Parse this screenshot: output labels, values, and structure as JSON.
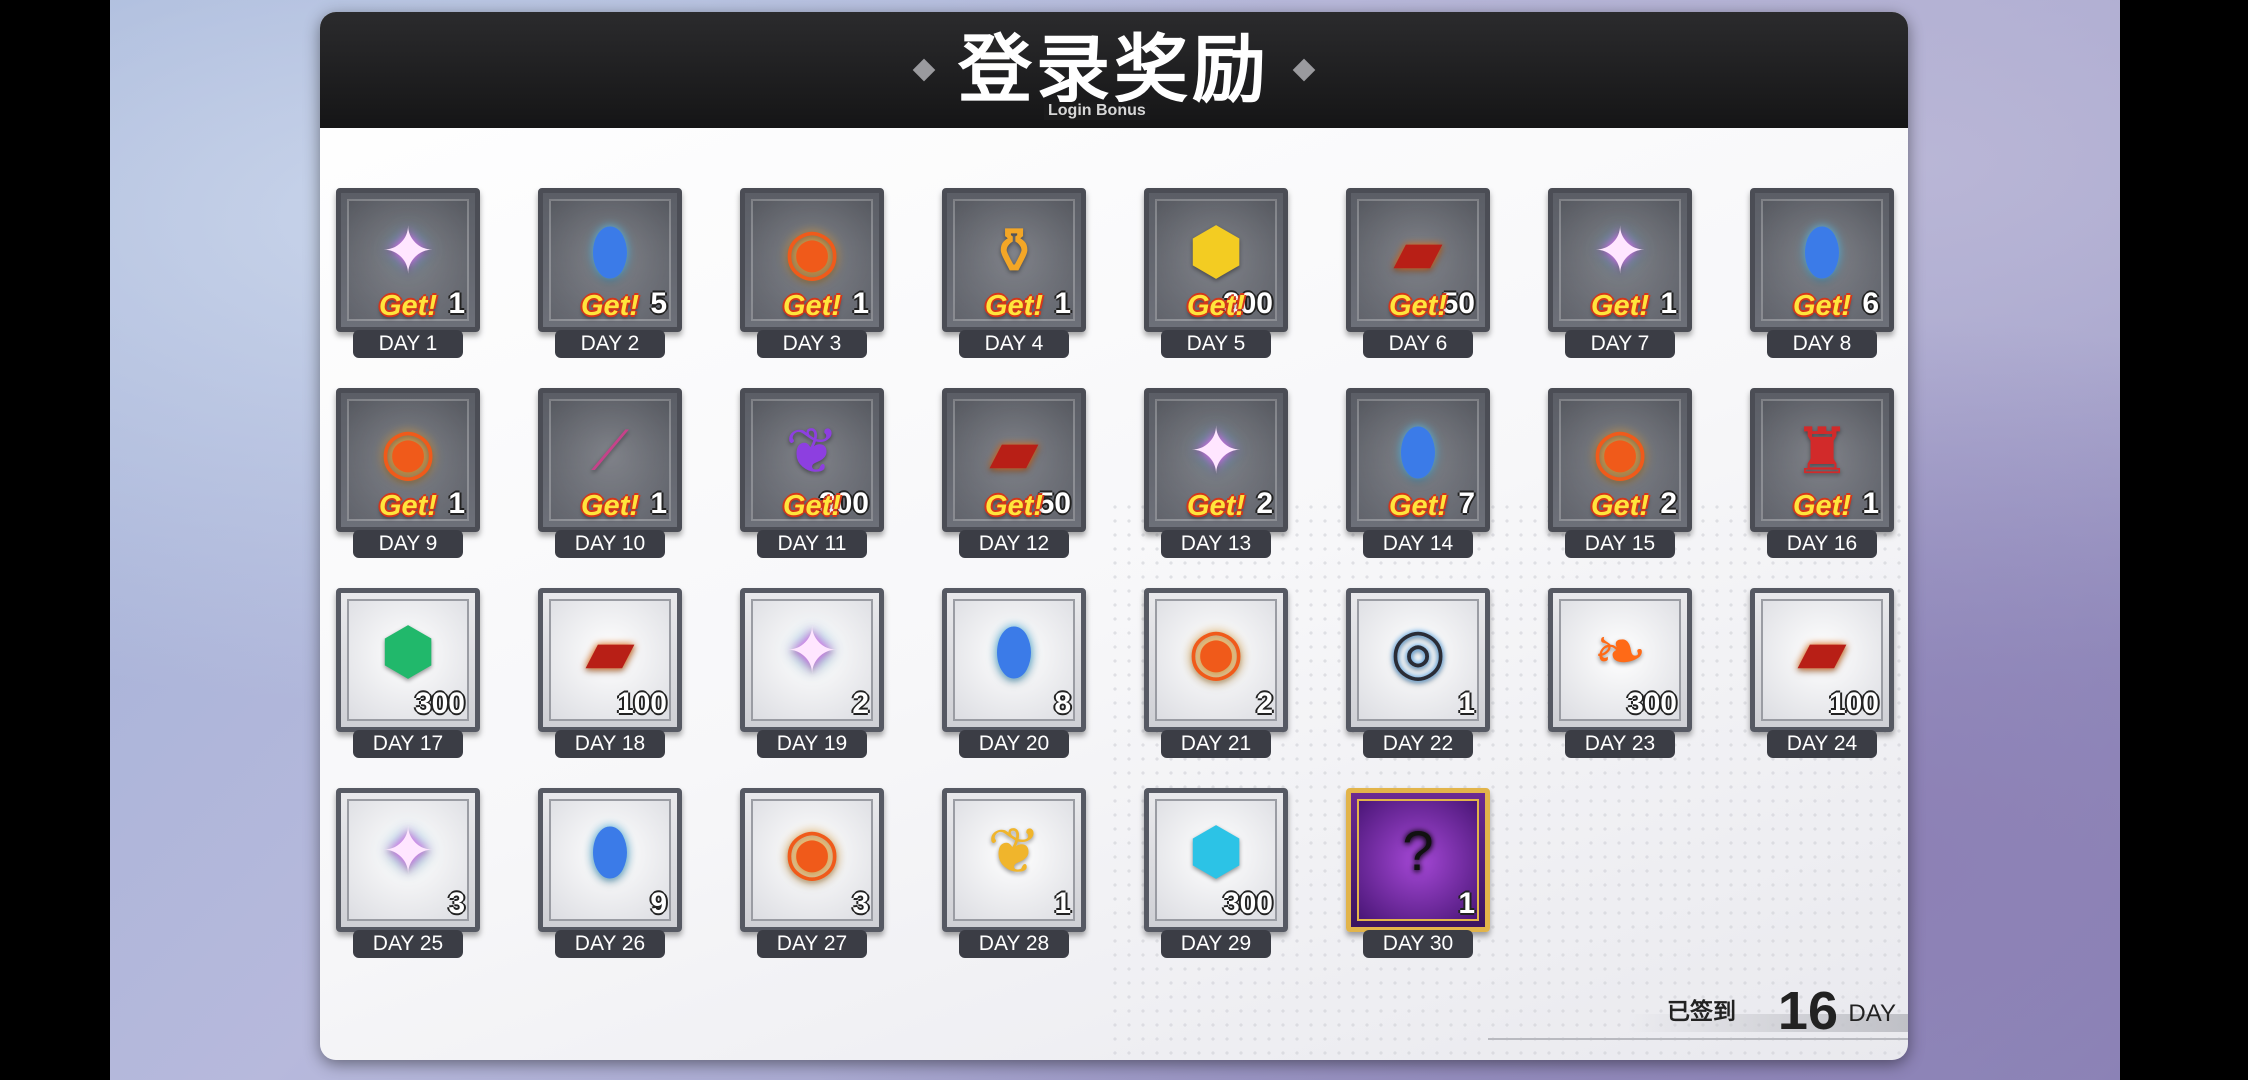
{
  "header": {
    "title": "登录奖励",
    "subtitle": "Login Bonus"
  },
  "days": [
    {
      "label": "DAY 1",
      "qty": "1",
      "icon": "rainbow-star",
      "got": true
    },
    {
      "label": "DAY 2",
      "qty": "5",
      "icon": "blue-crystal",
      "got": true
    },
    {
      "label": "DAY 3",
      "qty": "1",
      "icon": "fire-orb",
      "got": true
    },
    {
      "label": "DAY 4",
      "qty": "1",
      "icon": "honey-jar",
      "got": true
    },
    {
      "label": "DAY 5",
      "qty": "300",
      "icon": "gold-ore",
      "got": true
    },
    {
      "label": "DAY 6",
      "qty": "50",
      "icon": "lava-chest",
      "got": true
    },
    {
      "label": "DAY 7",
      "qty": "1",
      "icon": "rainbow-star",
      "got": true
    },
    {
      "label": "DAY 8",
      "qty": "6",
      "icon": "blue-crystal",
      "got": true
    },
    {
      "label": "DAY 9",
      "qty": "1",
      "icon": "fire-orb",
      "got": true
    },
    {
      "label": "DAY 10",
      "qty": "1",
      "icon": "rainbow-rifle",
      "got": true
    },
    {
      "label": "DAY 11",
      "qty": "300",
      "icon": "purple-feather",
      "got": true
    },
    {
      "label": "DAY 12",
      "qty": "50",
      "icon": "lava-chest",
      "got": true
    },
    {
      "label": "DAY 13",
      "qty": "2",
      "icon": "rainbow-star",
      "got": true
    },
    {
      "label": "DAY 14",
      "qty": "7",
      "icon": "blue-crystal",
      "got": true
    },
    {
      "label": "DAY 15",
      "qty": "2",
      "icon": "fire-orb",
      "got": true
    },
    {
      "label": "DAY 16",
      "qty": "1",
      "icon": "red-pouch",
      "got": true
    },
    {
      "label": "DAY 17",
      "qty": "300",
      "icon": "green-ore",
      "got": false
    },
    {
      "label": "DAY 18",
      "qty": "100",
      "icon": "lava-chest",
      "got": false
    },
    {
      "label": "DAY 19",
      "qty": "2",
      "icon": "rainbow-star",
      "got": false
    },
    {
      "label": "DAY 20",
      "qty": "8",
      "icon": "blue-crystal",
      "got": false
    },
    {
      "label": "DAY 21",
      "qty": "2",
      "icon": "fire-orb",
      "got": false
    },
    {
      "label": "DAY 22",
      "qty": "1",
      "icon": "black-bracelet",
      "got": false
    },
    {
      "label": "DAY 23",
      "qty": "300",
      "icon": "fire-feather",
      "got": false
    },
    {
      "label": "DAY 24",
      "qty": "100",
      "icon": "lava-chest",
      "got": false
    },
    {
      "label": "DAY 25",
      "qty": "3",
      "icon": "rainbow-star",
      "got": false
    },
    {
      "label": "DAY 26",
      "qty": "9",
      "icon": "blue-crystal",
      "got": false
    },
    {
      "label": "DAY 27",
      "qty": "3",
      "icon": "fire-orb",
      "got": false
    },
    {
      "label": "DAY 28",
      "qty": "1",
      "icon": "golden-wing",
      "got": false
    },
    {
      "label": "DAY 29",
      "qty": "300",
      "icon": "cyan-ore",
      "got": false
    },
    {
      "label": "DAY 30",
      "qty": "1",
      "icon": "mystery-silhouette",
      "got": false,
      "special": true
    }
  ],
  "get_label": "Get!",
  "footer": {
    "label": "已签到",
    "count": "16",
    "unit": "DAY"
  }
}
